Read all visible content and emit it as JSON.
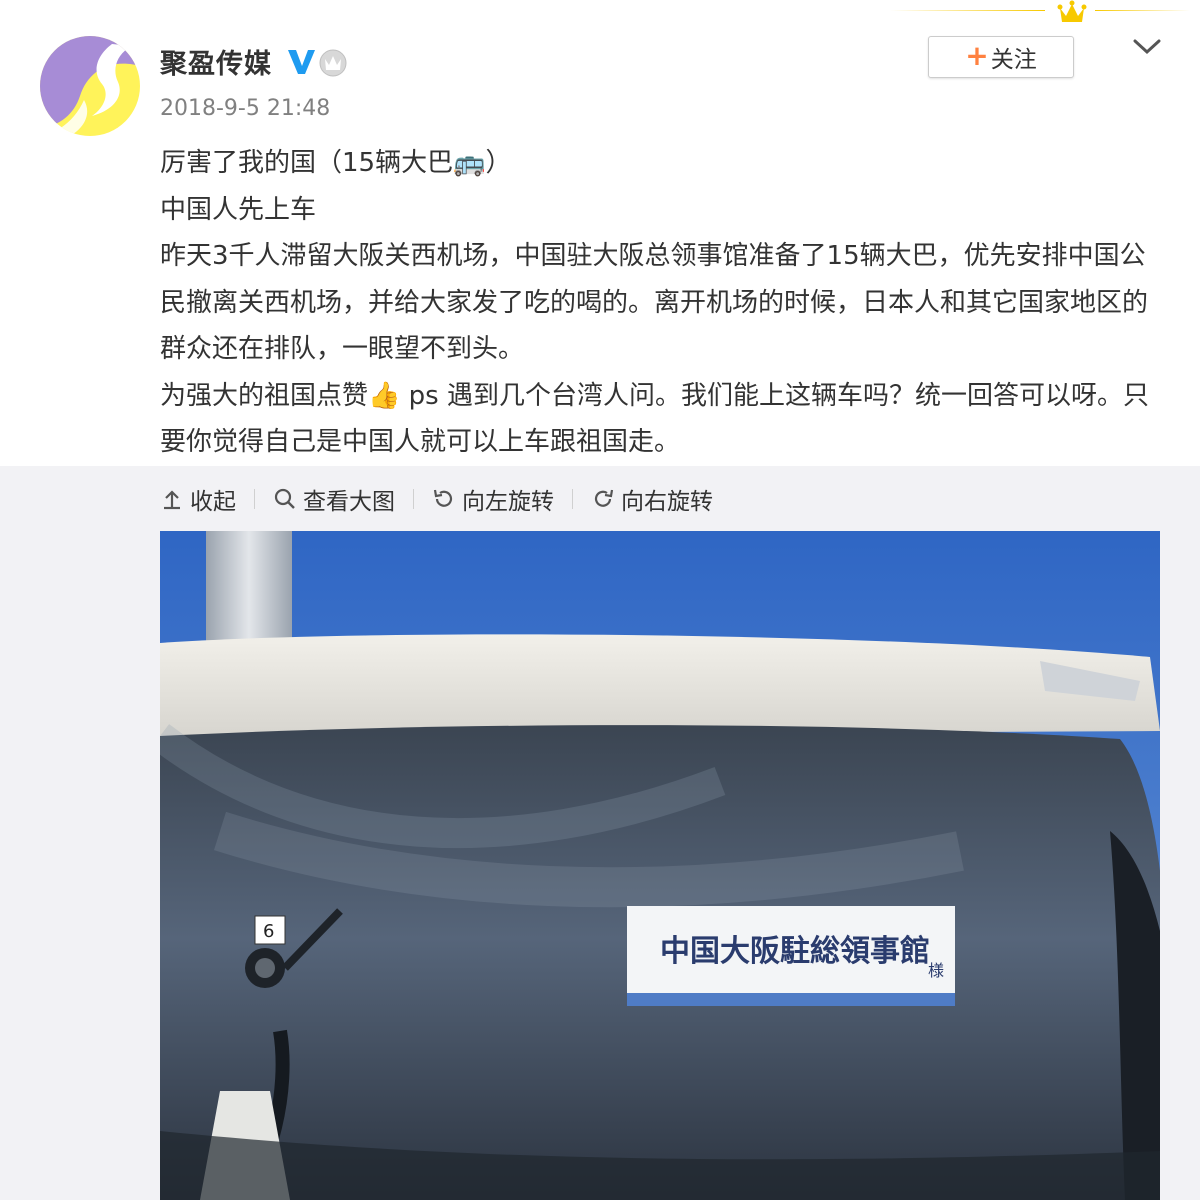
{
  "post": {
    "author": "聚盈传媒",
    "timestamp": "2018-9-5 21:48",
    "follow_label": "关注",
    "lines": [
      "厉害了我的国（15辆大巴🚌）",
      "中国人先上车",
      "昨天3千人滞留大阪关西机场，中国驻大阪总领事馆准备了15辆大巴，优先安排中国公民撤离关西机场，并给大家发了吃的喝的。离开机场的时候，日本人和其它国家地区的群众还在排队，一眼望不到头。",
      "为强大的祖国点赞👍 ps 遇到几个台湾人问。我们能上这辆车吗？统一回答可以呀。只要你觉得自己是中国人就可以上车跟祖国走。"
    ]
  },
  "toolbar": {
    "collapse": "收起",
    "view_large": "查看大图",
    "rotate_left": "向左旋转",
    "rotate_right": "向右旋转"
  },
  "photo": {
    "sign_text": "中国大阪駐総領事館",
    "sign_suffix": "様",
    "sticker_number": "6"
  },
  "icons": {
    "verified": "verified-v-icon",
    "member": "crown-member-icon",
    "more": "chevron-down-icon",
    "collapse": "collapse-up-icon",
    "view_large": "search-icon",
    "rotate_left": "rotate-left-icon",
    "rotate_right": "rotate-right-icon"
  },
  "colors": {
    "accent": "#ff8140",
    "verified": "#1e9bf0",
    "avatar_purple": "#a78cd6",
    "avatar_yellow": "#fff35a",
    "panel_bg": "#f2f2f5"
  }
}
